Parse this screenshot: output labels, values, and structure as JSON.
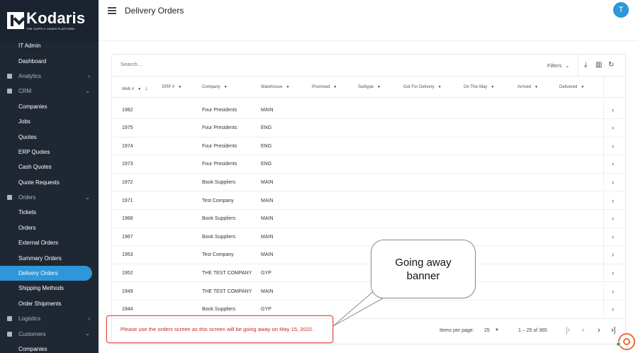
{
  "brand": {
    "name": "Kodaris",
    "tagline": "THE SUPPLY CHAIN PLATFORM"
  },
  "sidebar": {
    "items": [
      {
        "label": "IT Admin",
        "type": "child"
      },
      {
        "label": "Dashboard",
        "type": "child"
      },
      {
        "label": "Analytics",
        "type": "section",
        "chevron": "›"
      },
      {
        "label": "CRM",
        "type": "section",
        "chevron": "⌄"
      },
      {
        "label": "Companies",
        "type": "child"
      },
      {
        "label": "Jobs",
        "type": "child"
      },
      {
        "label": "Quotes",
        "type": "child"
      },
      {
        "label": "ERP Quotes",
        "type": "child"
      },
      {
        "label": "Cash Quotes",
        "type": "child"
      },
      {
        "label": "Quote Requests",
        "type": "child"
      },
      {
        "label": "Orders",
        "type": "section",
        "chevron": "⌄"
      },
      {
        "label": "Tickets",
        "type": "child"
      },
      {
        "label": "Orders",
        "type": "child"
      },
      {
        "label": "External Orders",
        "type": "child"
      },
      {
        "label": "Summary Orders",
        "type": "child"
      },
      {
        "label": "Delivery Orders",
        "type": "child",
        "active": true
      },
      {
        "label": "Shipping Methods",
        "type": "child"
      },
      {
        "label": "Order Shipments",
        "type": "child"
      },
      {
        "label": "Logistics",
        "type": "section",
        "chevron": "›"
      },
      {
        "label": "Customers",
        "type": "section",
        "chevron": "⌄"
      },
      {
        "label": "Companies",
        "type": "child"
      }
    ]
  },
  "header": {
    "title": "Delivery Orders",
    "avatar_letter": "T"
  },
  "toolbar": {
    "search_placeholder": "Search...",
    "filters_label": "Filters",
    "download_icon": "⤓",
    "columns_icon": "▥",
    "refresh_icon": "↻"
  },
  "table": {
    "columns": [
      {
        "label": "Web #",
        "sort": "↓"
      },
      {
        "label": "ERP #"
      },
      {
        "label": "Company"
      },
      {
        "label": "Warehouse"
      },
      {
        "label": "Promised"
      },
      {
        "label": "Subtype"
      },
      {
        "label": "Out For Delivery"
      },
      {
        "label": "On The Way"
      },
      {
        "label": "Arrived"
      },
      {
        "label": "Delivered"
      }
    ],
    "rows": [
      {
        "web": "1982",
        "company": "Four Presidents",
        "warehouse": "MAIN"
      },
      {
        "web": "1975",
        "company": "Four Presidents",
        "warehouse": "ENG"
      },
      {
        "web": "1974",
        "company": "Four Presidents",
        "warehouse": "ENG"
      },
      {
        "web": "1973",
        "company": "Four Presidents",
        "warehouse": "ENG"
      },
      {
        "web": "1972",
        "company": "Book Suppliers",
        "warehouse": "MAIN"
      },
      {
        "web": "1971",
        "company": "Test Company",
        "warehouse": "MAIN"
      },
      {
        "web": "1968",
        "company": "Book Suppliers",
        "warehouse": "MAIN"
      },
      {
        "web": "1967",
        "company": "Book Suppliers",
        "warehouse": "MAIN"
      },
      {
        "web": "1953",
        "company": "Test Company",
        "warehouse": "MAIN"
      },
      {
        "web": "1952",
        "company": "THE TEST COMPANY",
        "warehouse": "GYP"
      },
      {
        "web": "1949",
        "company": "THE TEST COMPANY",
        "warehouse": "MAIN"
      },
      {
        "web": "1944",
        "company": "Book Suppliers",
        "warehouse": "GYP"
      }
    ]
  },
  "pagination": {
    "items_per_page_label": "Items per page:",
    "items_per_page": "25",
    "range": "1 – 25 of 365",
    "first": "|‹",
    "prev": "‹",
    "next": "›",
    "last": "›|"
  },
  "banner": {
    "text": "Please use the orders screen as this screen will be going away on May 15, 2022."
  },
  "callout": {
    "text": "Going away banner"
  },
  "colors": {
    "accent": "#2d97d9",
    "sidebar": "#1f2733",
    "banner_text": "#c62828",
    "chat": "#f06a30"
  }
}
